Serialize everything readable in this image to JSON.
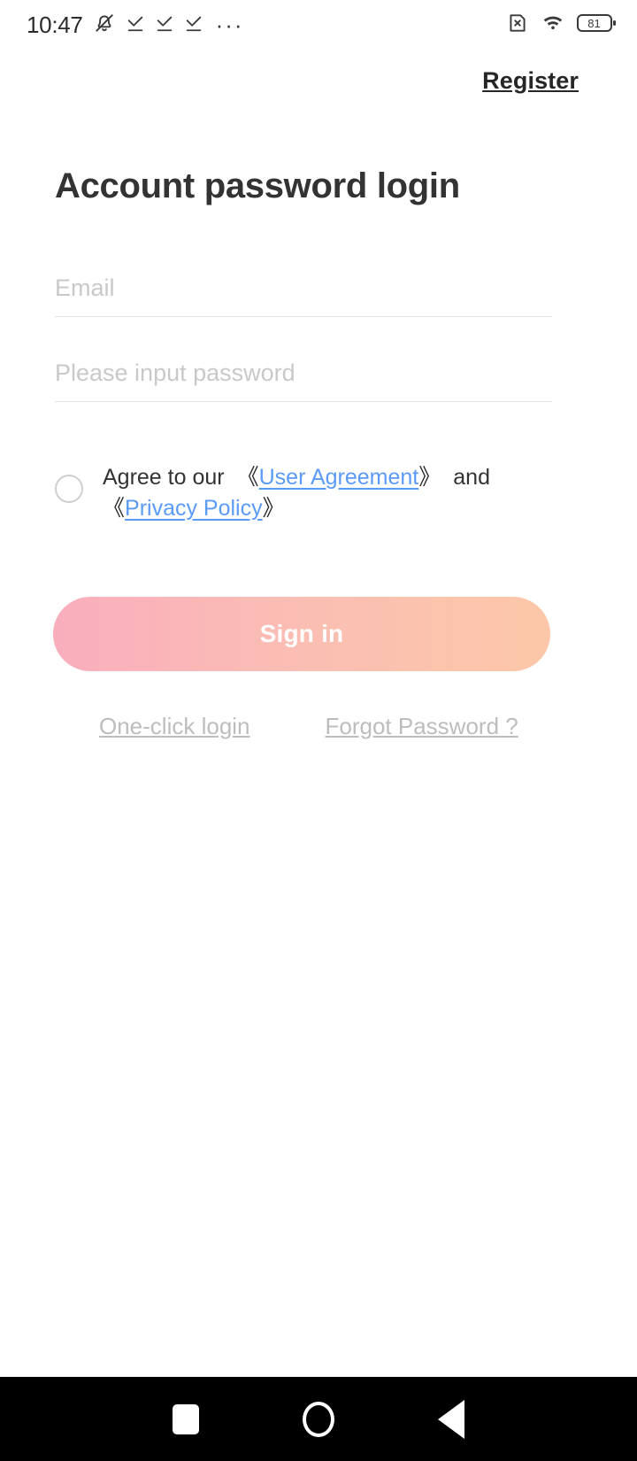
{
  "status_bar": {
    "time": "10:47",
    "battery_level": "81",
    "icons": [
      "silent-bell-icon",
      "download-complete-icon",
      "download-complete-icon",
      "download-complete-icon",
      "more-dots-icon",
      "sim-disabled-icon",
      "wifi-icon",
      "battery-icon"
    ],
    "dots": "···"
  },
  "header": {
    "register_label": "Register"
  },
  "main": {
    "title": "Account password login",
    "fields": {
      "email": {
        "placeholder": "Email",
        "value": ""
      },
      "password": {
        "placeholder": "Please input password",
        "value": ""
      }
    },
    "agreement": {
      "checked": false,
      "prefix": "Agree to our",
      "bracket_open": "《",
      "bracket_close": "》",
      "user_agreement": "User Agreement",
      "conjunction": "and",
      "privacy_policy": "Privacy Policy"
    },
    "sign_in_label": "Sign in",
    "one_click_login_label": "One-click login",
    "forgot_password_label": "Forgot Password ?"
  },
  "colors": {
    "link_blue": "#5b9bf8",
    "button_gradient_start": "#f9aebd",
    "button_gradient_end": "#fcc7a8",
    "placeholder_gray": "#c9c9c9",
    "muted_link_gray": "#bdbdbd"
  },
  "nav_bar": {
    "recents_label": "recents-square",
    "home_label": "home-circle",
    "back_label": "back-triangle"
  }
}
